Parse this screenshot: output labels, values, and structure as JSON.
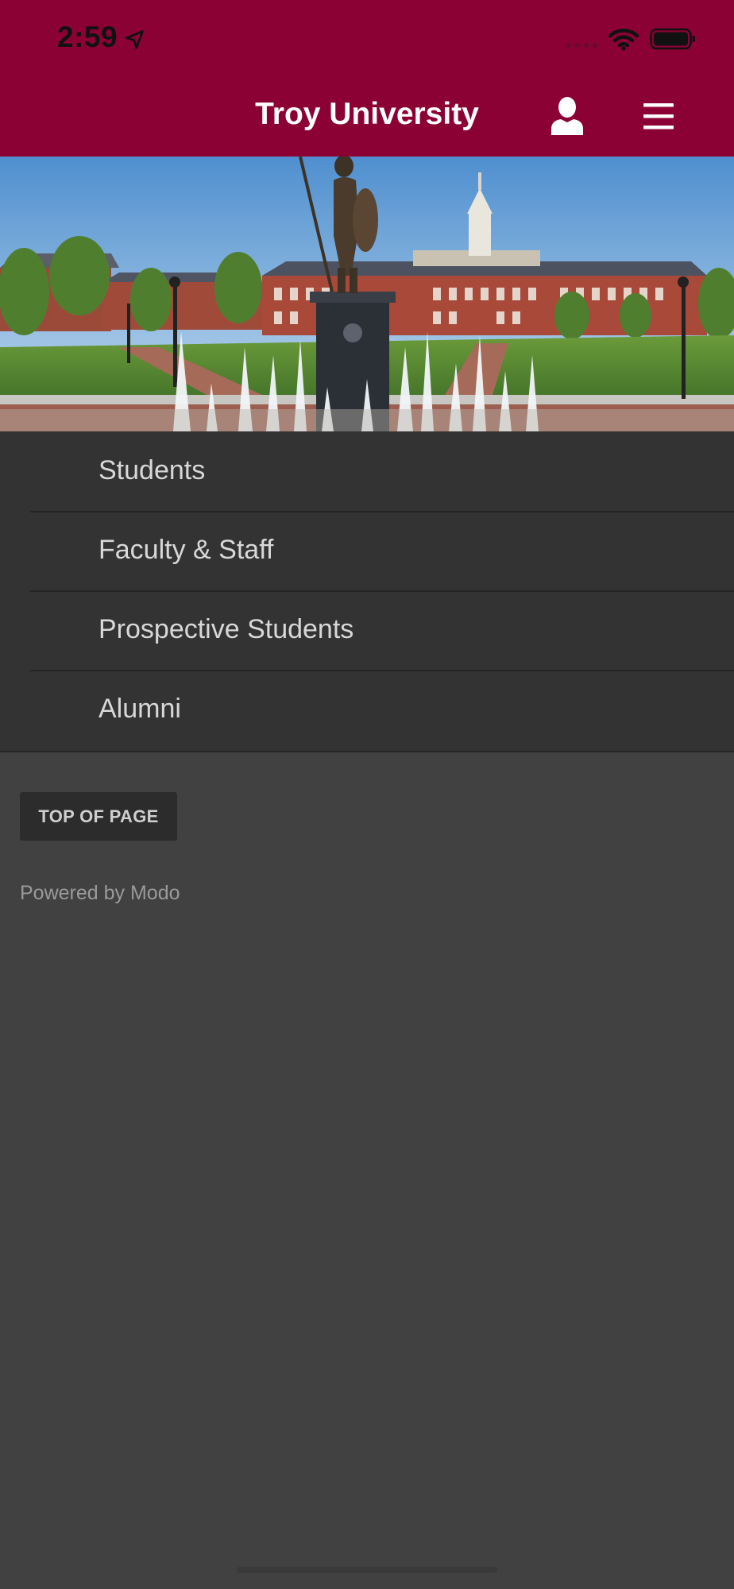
{
  "status_bar": {
    "time": "2:59",
    "location_icon": "location-arrow-icon",
    "signal_icon": "cellular-signal-icon",
    "wifi_icon": "wifi-icon",
    "battery_icon": "battery-full-icon"
  },
  "header": {
    "title": "Troy University",
    "background_color": "#8c0133",
    "user_icon": "user-icon",
    "menu_icon": "hamburger-menu-icon"
  },
  "banner": {
    "icon": "campus-photo-trojan-statue"
  },
  "nav": {
    "items": [
      {
        "label": "Students"
      },
      {
        "label": "Faculty & Staff"
      },
      {
        "label": "Prospective Students"
      },
      {
        "label": "Alumni"
      }
    ]
  },
  "footer": {
    "top_button_label": "TOP OF PAGE",
    "powered_by": "Powered by Modo"
  }
}
